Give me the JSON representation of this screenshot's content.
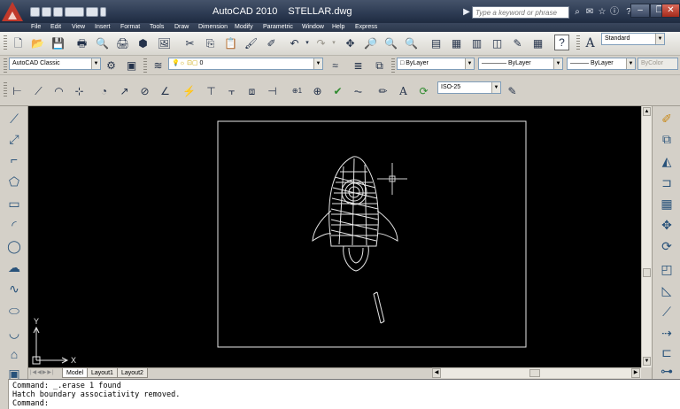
{
  "window": {
    "app_name": "AutoCAD 2010",
    "file_name": "STELLAR.dwg",
    "search_placeholder": "Type a keyword or phrase"
  },
  "menu": [
    "File",
    "Edit",
    "View",
    "Insert",
    "Format",
    "Tools",
    "Draw",
    "Dimension",
    "Modify",
    "Parametric",
    "Window",
    "Help",
    "Express"
  ],
  "toolbars": {
    "workspace": "AutoCAD Classic",
    "layer_value": "0",
    "text_style": "Standard",
    "color": "ByLayer",
    "linetype": "ByLayer",
    "lineweight": "ByLayer",
    "plot_style": "ByColor",
    "dim_style": "ISO-25"
  },
  "canvas": {
    "ucs_x_label": "X",
    "ucs_y_label": "Y"
  },
  "layout_tabs": [
    "Model",
    "Layout1",
    "Layout2"
  ],
  "command_line": [
    "Command: _.erase 1 found",
    "Hatch boundary associativity removed.",
    "Command:"
  ]
}
